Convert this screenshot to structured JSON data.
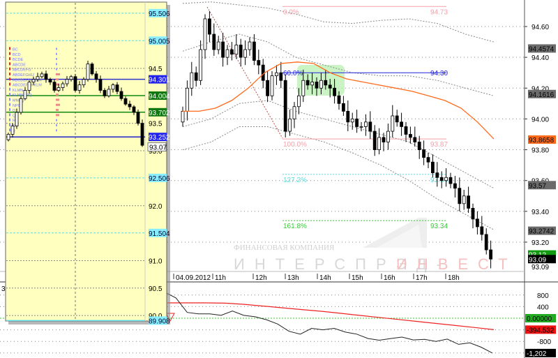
{
  "chart_data": {
    "type": "candlestick",
    "main": {
      "ylim": [
        93.07,
        94.78
      ],
      "y_ticks": [
        "94.60",
        "94.40",
        "94.20",
        "94.00",
        "93.80",
        "93.60",
        "93.40",
        "93.20"
      ],
      "x_ticks": [
        "04.09.2012",
        "11h",
        "12h",
        "13h",
        "14h",
        "15h",
        "16h",
        "17h",
        "18h"
      ],
      "closes": [
        94.05,
        94.2,
        94.3,
        94.25,
        94.45,
        94.65,
        94.55,
        94.45,
        94.5,
        94.4,
        94.45,
        94.42,
        94.48,
        94.4,
        94.45,
        94.5,
        94.38,
        94.35,
        94.25,
        94.15,
        94.28,
        94.3,
        94.25,
        93.92,
        94.0,
        94.08,
        94.15,
        94.25,
        94.22,
        94.24,
        94.2,
        94.25,
        94.22,
        94.2,
        94.15,
        94.1,
        94.05,
        93.98,
        94.0,
        93.95,
        93.95,
        93.98,
        93.92,
        93.8,
        93.88,
        93.85,
        93.92,
        94.02,
        93.98,
        93.95,
        93.9,
        93.88,
        93.85,
        93.8,
        93.75,
        93.72,
        93.65,
        93.62,
        93.6,
        93.62,
        93.58,
        93.55,
        93.45,
        93.5,
        93.42,
        93.35,
        93.3,
        93.25,
        93.15,
        93.09
      ],
      "first_open": 93.98,
      "moving_average": [
        94.05,
        94.05,
        94.07,
        94.12,
        94.2,
        94.3,
        94.36,
        94.37,
        94.36,
        94.3,
        94.26,
        94.24,
        94.22,
        94.2,
        94.18,
        94.15,
        94.12,
        94.07,
        93.98,
        93.87
      ],
      "band_upper_outer": [
        94.75,
        94.76,
        94.74,
        94.72,
        94.68,
        94.63,
        94.62,
        94.64,
        94.65,
        94.62,
        94.55,
        94.5
      ],
      "band_upper": [
        94.44,
        94.5,
        94.55,
        94.5,
        94.4,
        94.35,
        94.3,
        94.28,
        94.28,
        94.25,
        94.2,
        94.15
      ],
      "band_lower": [
        93.95,
        94.0,
        94.1,
        94.12,
        94.05,
        94.0,
        93.95,
        93.9,
        93.85,
        93.75,
        93.65,
        93.55
      ],
      "band_lower_outer": [
        93.8,
        93.85,
        93.95,
        93.95,
        93.9,
        93.85,
        93.78,
        93.7,
        93.6,
        93.48,
        93.38,
        93.28
      ],
      "axis_labels": [
        {
          "text": "94.4574",
          "value": 94.4574,
          "bg": "#6b6b6b",
          "fg": "#000000"
        },
        {
          "text": "94.1616",
          "value": 94.1616,
          "bg": "#6b6b6b",
          "fg": "#000000"
        },
        {
          "text": "93.8658",
          "value": 93.8658,
          "bg": "#ff6a1a",
          "fg": "#000000"
        },
        {
          "text": "93.57",
          "value": 93.57,
          "bg": "#6b6b6b",
          "fg": "#000000"
        },
        {
          "text": "93.2742",
          "value": 93.2742,
          "bg": "#6b6b6b",
          "fg": "#000000"
        },
        {
          "text": "93.12",
          "value": 93.12,
          "bg": "#119911",
          "fg": "#ffffff"
        },
        {
          "text": "93.09",
          "value": 93.09,
          "bg": "#000000",
          "fg": "#ffffff"
        }
      ],
      "last_price_text": "93.09",
      "fibonacci": [
        {
          "level": "0.0%",
          "price": "94.73",
          "value": 94.73,
          "color": "#f4a0a8"
        },
        {
          "level": "60.0%",
          "price": "94.30",
          "value": 94.3,
          "color": "#2222dd"
        },
        {
          "level": "100.0%",
          "price": "93.87",
          "value": 93.87,
          "color": "#f4a0a8"
        },
        {
          "level": "127.2%",
          "price": "93.64",
          "value": 93.64,
          "color": "#55dddd"
        },
        {
          "level": "161.8%",
          "price": "93.34",
          "value": 93.34,
          "color": "#33cc33"
        }
      ]
    },
    "profile_panel": {
      "ylim": [
        89.9,
        95.55
      ],
      "y_ticks": [
        "94.5",
        "93.5",
        "93.0",
        "92.0",
        "91.0",
        "90.5",
        "90.0"
      ],
      "levels": [
        {
          "text": "95.506",
          "value": 95.506,
          "color": "#55ddee",
          "style": "dash"
        },
        {
          "text": "95.005",
          "value": 95.005,
          "color": "#55ddee",
          "style": "dash"
        },
        {
          "text": "94.301",
          "value": 94.301,
          "color": "#3333cc",
          "style": "solid",
          "bg": "#2222ee"
        },
        {
          "text": "94.004",
          "value": 94.004,
          "color": "#118811",
          "style": "solid",
          "bg": "#117711"
        },
        {
          "text": "93.702",
          "value": 93.702,
          "color": "#118811",
          "style": "solid",
          "bg": "#117711"
        },
        {
          "text": "93.252",
          "value": 93.252,
          "color": "#2222cc",
          "style": "solid",
          "bg": "#2222ee"
        },
        {
          "text": "92.506",
          "value": 92.506,
          "color": "#55ddee",
          "style": "dash"
        },
        {
          "text": "91.504",
          "value": 91.504,
          "color": "#55ddee",
          "style": "dash"
        },
        {
          "text": "89.908",
          "value": 89.908,
          "color": "#55ddee",
          "style": "solid"
        }
      ],
      "last_price_text": "93.07",
      "closes": [
        93.3,
        93.45,
        93.7,
        93.95,
        94.1,
        94.25,
        94.3,
        94.35,
        94.4,
        94.3,
        94.25,
        94.1,
        94.15,
        94.22,
        94.3,
        94.35,
        94.1,
        94.2,
        94.3,
        94.58,
        94.4,
        94.3,
        94.1,
        94.0,
        94.12,
        94.2,
        94.08,
        93.95,
        93.85,
        93.8,
        93.7,
        93.5,
        93.1
      ],
      "profile_rows": [
        "BC",
        "BCD",
        "BCDE",
        "ABCDE",
        "ABCDEFG",
        "ABDEFGHIJ",
        "ABCDEFGHKLM",
        "ABCDEFGHKLM",
        "KLMN",
        "KLMNOPQ",
        "MNPQ",
        "NPQ",
        "Q",
        "Q",
        "R",
        "R",
        "R"
      ]
    },
    "oscillator": {
      "y_ticks": [
        "800",
        "400",
        "-800"
      ],
      "ylim": [
        -1250,
        950
      ],
      "signal_line": [
        530,
        530,
        530,
        520,
        480,
        420,
        360,
        300,
        240,
        170,
        100,
        30,
        -40,
        -110,
        -180,
        -250,
        -320,
        -394.532
      ],
      "value_line": [
        900,
        700,
        200,
        150,
        150,
        100,
        250,
        100,
        50,
        -50,
        -200,
        -450,
        -550,
        -350,
        -400,
        -350,
        -480,
        -550,
        -700,
        -760,
        -700,
        -650,
        -750,
        -730,
        -800,
        -720,
        -900,
        -850,
        -1000,
        -1202
      ],
      "zero_label": "0.00000",
      "signal_label": "-394.532",
      "value_label": "-1,202"
    }
  },
  "watermark": {
    "line1": "ФИНАНСОВАЯ КОМПАНИЯ",
    "part1": "ИНТЕРСПРЭД-",
    "part2": "ИНВЕСТ"
  }
}
